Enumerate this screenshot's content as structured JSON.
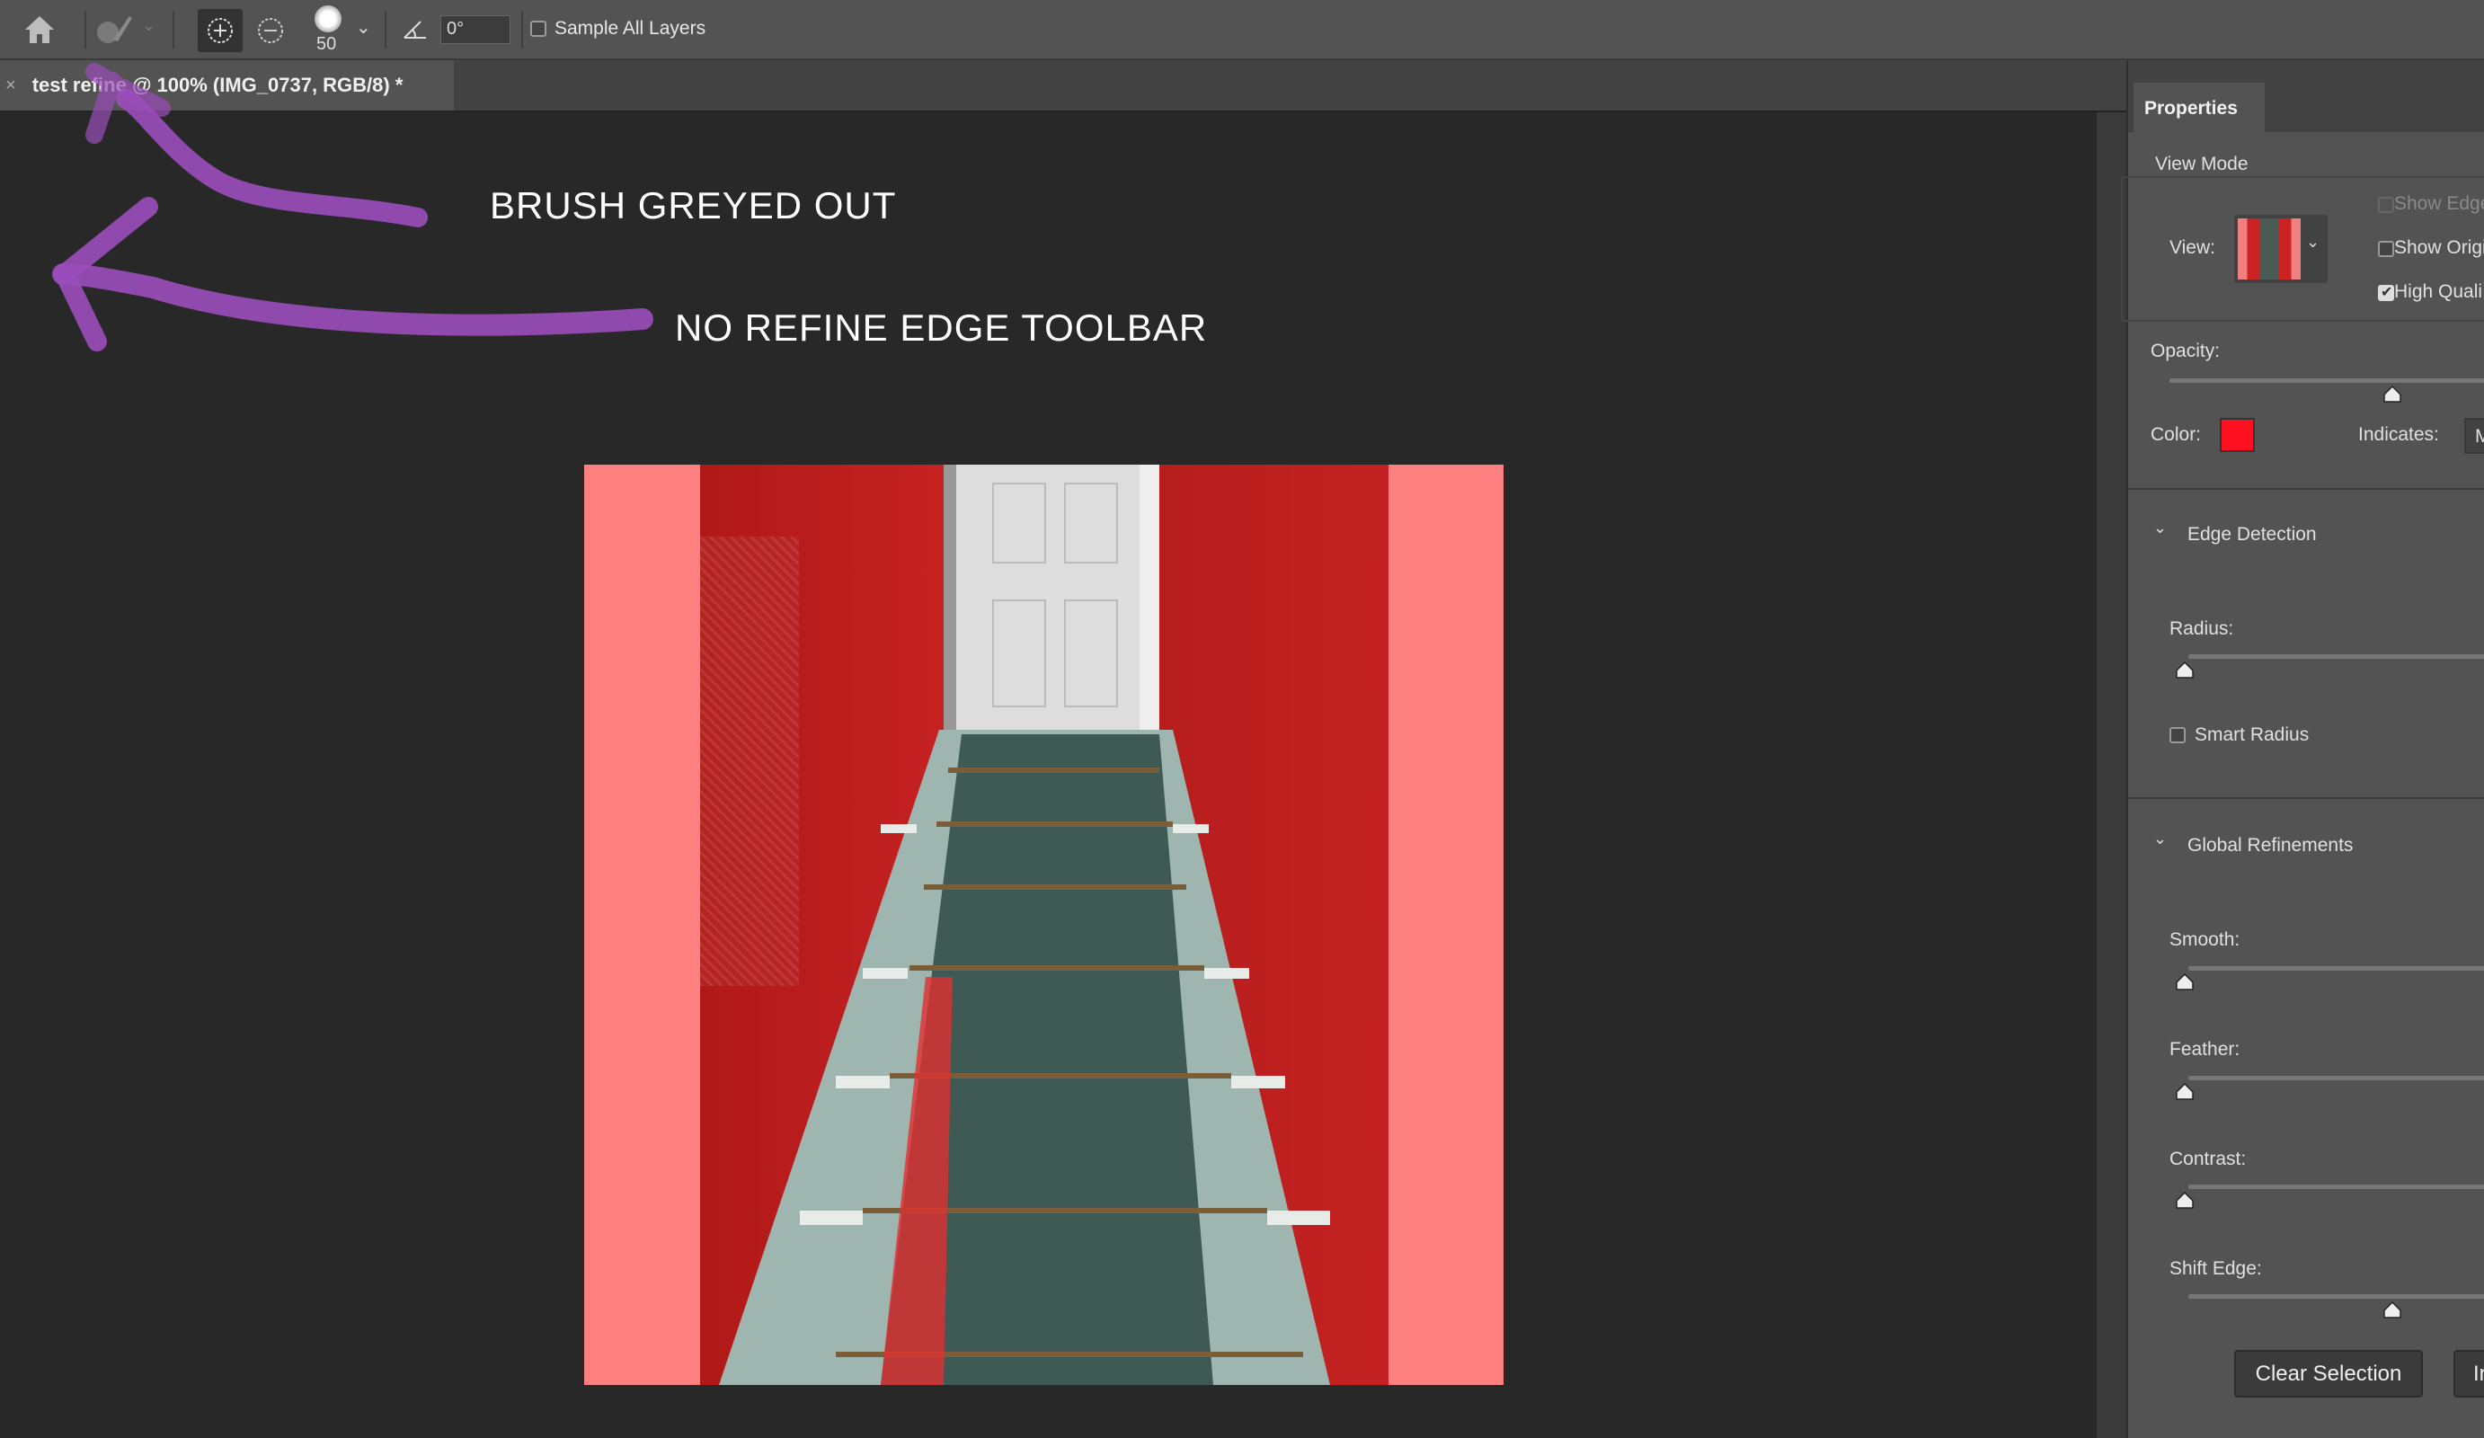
{
  "toolbar": {
    "brush_size": "50",
    "angle": "0°",
    "sample_all_layers": "Sample All Layers",
    "sample_all_layers_checked": false,
    "icons": [
      "home-icon",
      "brush-icon",
      "add-to-selection-icon",
      "subtract-from-selection-icon",
      "brush-preset-icon",
      "angle-icon"
    ]
  },
  "document_tab": {
    "close": "×",
    "title": "test refine @ 100% (IMG_0737, RGB/8) *"
  },
  "annotations": {
    "note1": "BRUSH GREYED OUT",
    "note2": "NO REFINE EDGE TOOLBAR",
    "arrow_color": "#9b4dbb"
  },
  "panel": {
    "tab": "Properties",
    "view_mode": {
      "title": "View Mode",
      "view_label": "View:",
      "show_edge": "Show Edge",
      "show_edge_checked": false,
      "show_original": "Show Origi",
      "show_original_checked": false,
      "high_quality": "High Quali",
      "high_quality_checked": true
    },
    "opacity": {
      "label": "Opacity:",
      "value_fraction": 0.5
    },
    "color": {
      "label": "Color:",
      "value": "#ff1020"
    },
    "indicates": {
      "label": "Indicates:",
      "value": "M"
    },
    "edge_detection": {
      "title": "Edge Detection",
      "radius_label": "Radius:",
      "radius_value": 0,
      "smart_radius": "Smart Radius",
      "smart_radius_checked": false
    },
    "global_refinements": {
      "title": "Global Refinements",
      "smooth_label": "Smooth:",
      "smooth_value": 0,
      "feather_label": "Feather:",
      "feather_value": 0,
      "contrast_label": "Contrast:",
      "contrast_value": 0,
      "shift_edge_label": "Shift Edge:",
      "shift_edge_value": 0
    },
    "buttons": {
      "clear_selection": "Clear Selection",
      "invert": "In"
    }
  }
}
